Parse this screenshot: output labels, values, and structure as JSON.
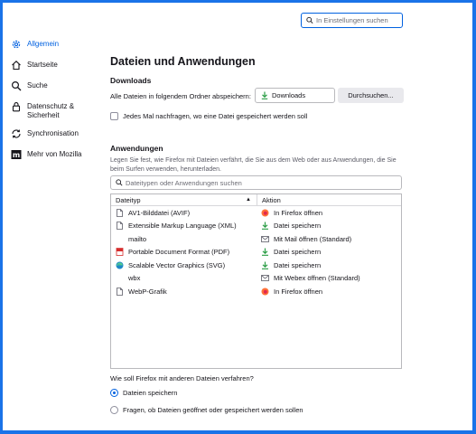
{
  "search": {
    "placeholder": "In Einstellungen suchen"
  },
  "sidebar": {
    "items": [
      {
        "label": "Allgemein",
        "icon": "gear-icon",
        "active": true
      },
      {
        "label": "Startseite",
        "icon": "home-icon"
      },
      {
        "label": "Suche",
        "icon": "search-icon"
      },
      {
        "label": "Datenschutz & Sicherheit",
        "icon": "lock-icon"
      },
      {
        "label": "Synchronisation",
        "icon": "sync-icon"
      },
      {
        "label": "Mehr von Mozilla",
        "icon": "mozilla-icon"
      }
    ]
  },
  "main": {
    "title": "Dateien und Anwendungen",
    "downloads": {
      "heading": "Downloads",
      "save_label": "Alle Dateien in folgendem Ordner abspeichern:",
      "folder": "Downloads",
      "browse_button": "Durchsuchen...",
      "ask_label": "Jedes Mal nachfragen, wo eine Datei gespeichert werden soll",
      "ask_checked": false
    },
    "apps": {
      "heading": "Anwendungen",
      "description": "Legen Sie fest, wie Firefox mit Dateien verfährt, die Sie aus dem Web oder aus Anwendungen, die Sie beim Surfen verwenden, herunterladen.",
      "filter_placeholder": "Dateitypen oder Anwendungen suchen",
      "columns": [
        "Dateityp",
        "Aktion"
      ],
      "rows": [
        {
          "type": "AV1-Bilddatei (AVIF)",
          "type_icon": "file-icon",
          "action": "In Firefox öffnen",
          "action_icon": "firefox-icon"
        },
        {
          "type": "Extensible Markup Language (XML)",
          "type_icon": "file-icon",
          "action": "Datei speichern",
          "action_icon": "download-icon"
        },
        {
          "type": "mailto",
          "type_icon": "",
          "action": "Mit Mail öffnen (Standard)",
          "action_icon": "mail-app-icon"
        },
        {
          "type": "Portable Document Format (PDF)",
          "type_icon": "pdf-icon",
          "action": "Datei speichern",
          "action_icon": "download-icon"
        },
        {
          "type": "Scalable Vector Graphics (SVG)",
          "type_icon": "edge-icon",
          "action": "Datei speichern",
          "action_icon": "download-icon"
        },
        {
          "type": "wbx",
          "type_icon": "",
          "action": "Mit Webex öffnen (Standard)",
          "action_icon": "webex-app-icon"
        },
        {
          "type": "WebP-Grafik",
          "type_icon": "file-icon",
          "action": "In Firefox öffnen",
          "action_icon": "firefox-icon"
        }
      ]
    },
    "other_files": {
      "question": "Wie soll Firefox mit anderen Dateien verfahren?",
      "options": [
        {
          "label": "Dateien speichern",
          "selected": true
        },
        {
          "label": "Fragen, ob Dateien geöffnet oder gespeichert werden sollen",
          "selected": false
        }
      ]
    }
  },
  "colors": {
    "accent": "#0061e0",
    "frame": "#1a73e8",
    "button": "#e9e9ed"
  }
}
